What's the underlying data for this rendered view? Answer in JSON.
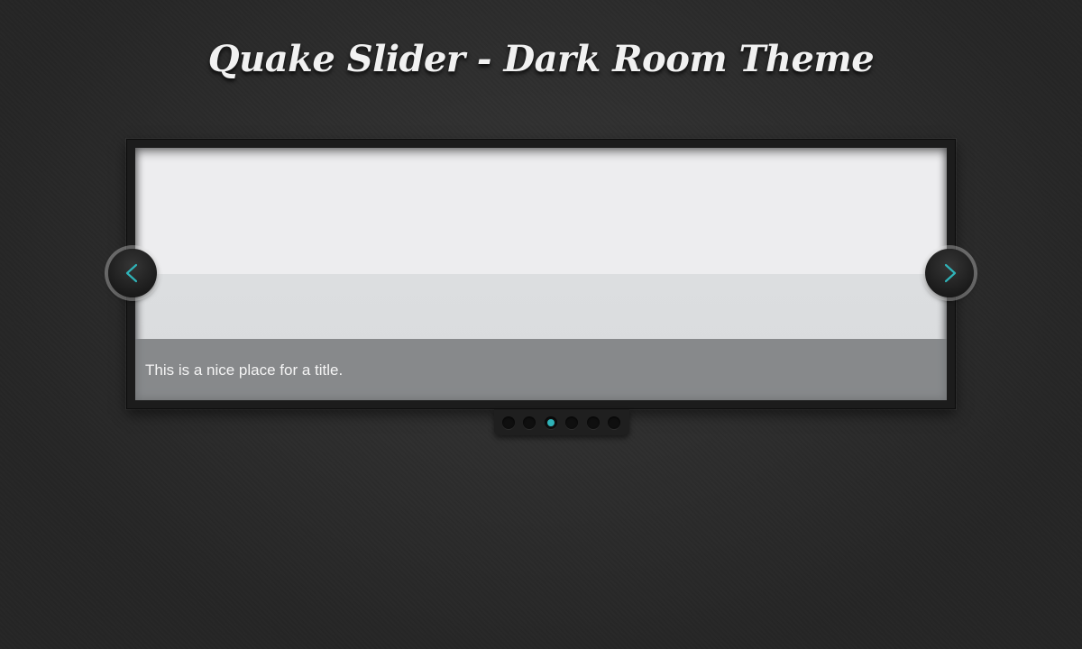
{
  "page": {
    "title": "Quake Slider - Dark Room Theme"
  },
  "slider": {
    "caption": "This is a nice place for a title.",
    "prev_icon": "chevron-left-icon",
    "next_icon": "chevron-right-icon",
    "accent_color": "#2fb3b8",
    "slide_count": 6,
    "active_slide": 3
  }
}
